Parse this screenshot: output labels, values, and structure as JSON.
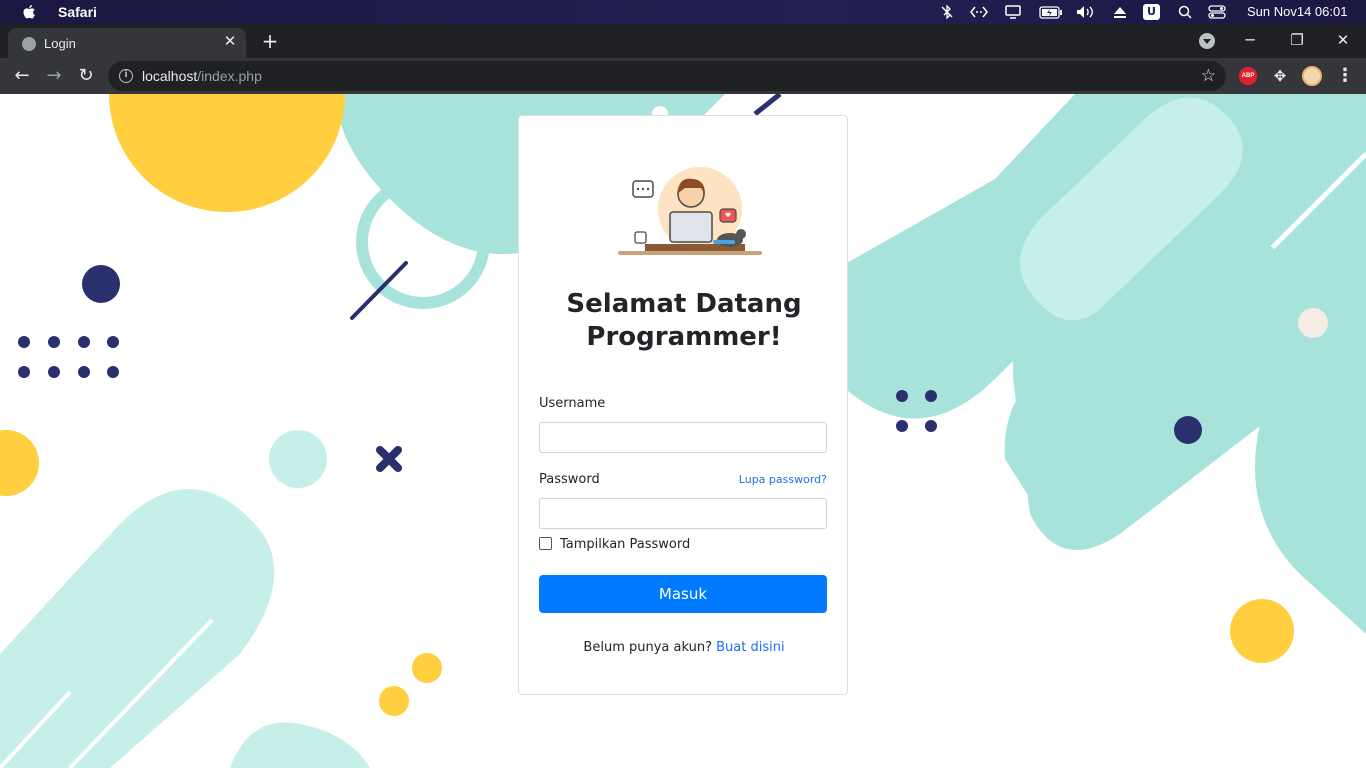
{
  "menubar": {
    "app_name": "Safari",
    "clock": "Sun Nov14  06:01",
    "tray_icons": [
      "bluetooth-off-icon",
      "code-icon",
      "display-icon",
      "battery-icon",
      "volume-icon",
      "eject-icon",
      "u-app-icon",
      "search-icon",
      "control-center-icon"
    ]
  },
  "browser": {
    "tab_title": "Login",
    "new_tab": "+",
    "url_host": "localhost",
    "url_path": "/index.php",
    "abp_label": "ABP"
  },
  "login": {
    "heading_line1": "Selamat Datang",
    "heading_line2": "Programmer!",
    "username_label": "Username",
    "username_value": "",
    "password_label": "Password",
    "password_value": "",
    "forgot_link": "Lupa password?",
    "show_password_label": "Tampilkan Password",
    "show_password_checked": false,
    "submit_label": "Masuk",
    "signup_text": "Belum punya akun?",
    "signup_link": "Buat disini"
  },
  "colors": {
    "primary": "#007bff",
    "link": "#1a73e8",
    "teal": "#a7e3db",
    "yellow": "#ffcf3f",
    "navy": "#2a2f6e"
  }
}
